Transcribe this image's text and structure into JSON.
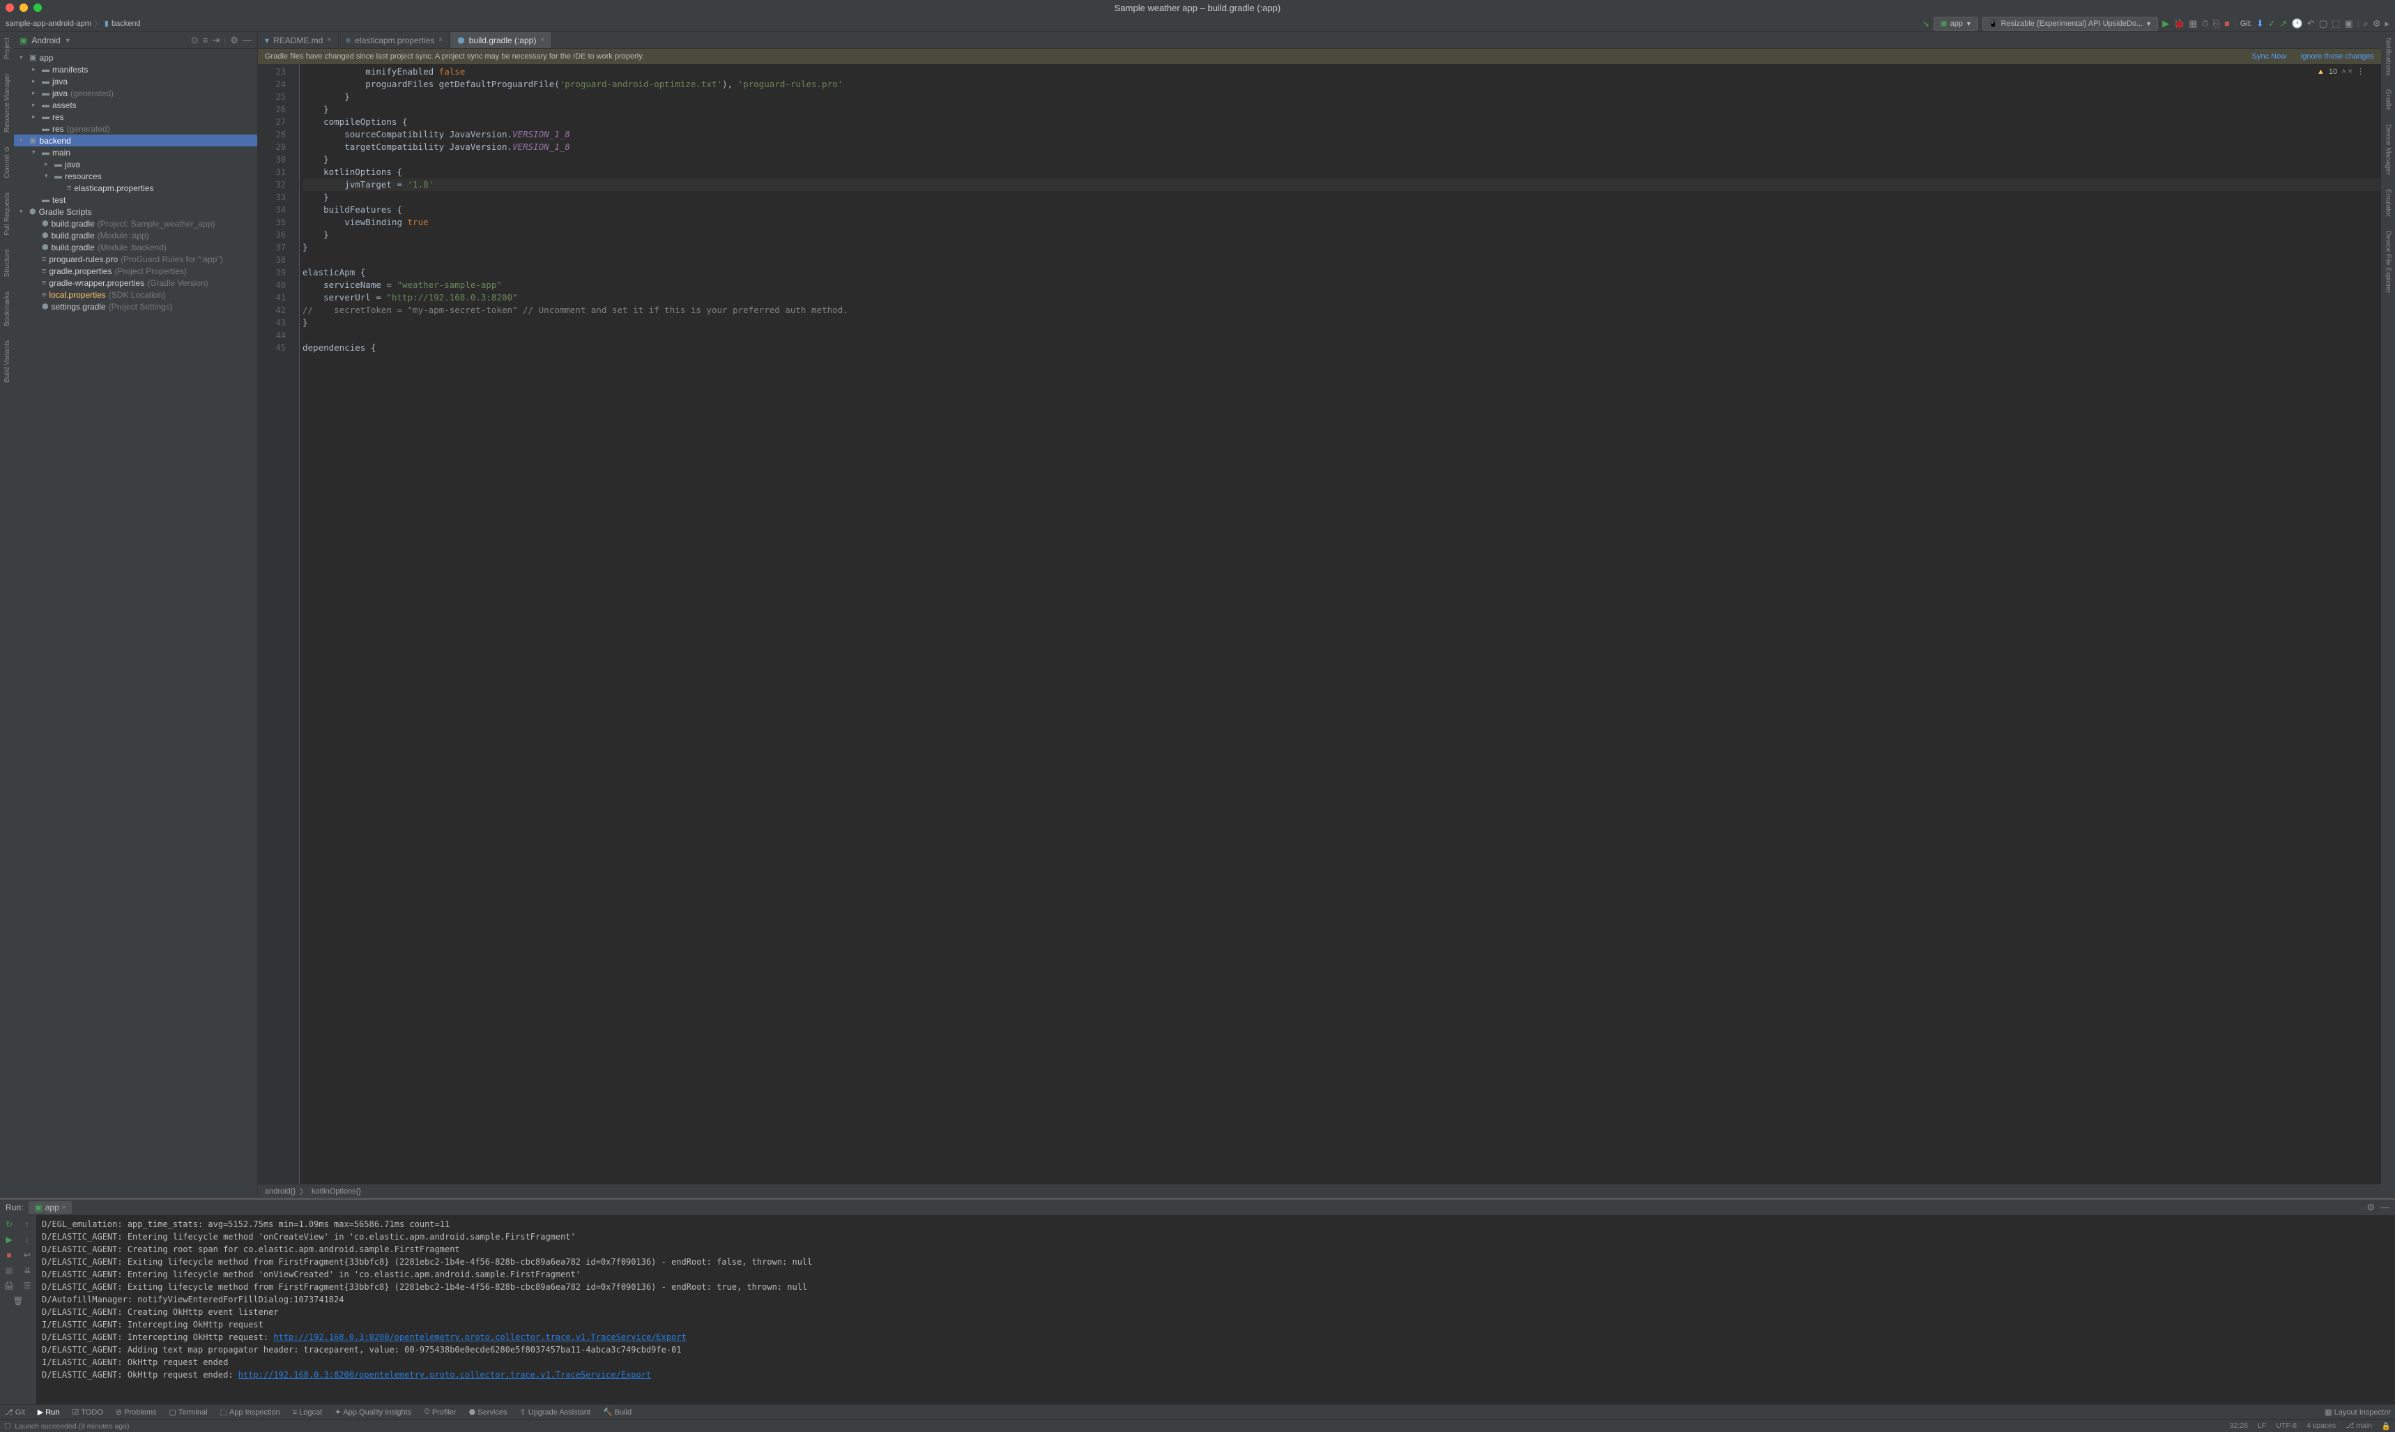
{
  "title": "Sample weather app – build.gradle (:app)",
  "breadcrumb": [
    "sample-app-android-apm",
    "backend"
  ],
  "run_config": "app",
  "device": "Resizable (Experimental) API UpsideDo...",
  "git_label": "Git:",
  "sidebar": {
    "mode": "Android",
    "tree": [
      {
        "d": 0,
        "arr": "v",
        "ic": "module",
        "label": "app",
        "sel": false
      },
      {
        "d": 1,
        "arr": ">",
        "ic": "folder",
        "label": "manifests"
      },
      {
        "d": 1,
        "arr": ">",
        "ic": "folder",
        "label": "java"
      },
      {
        "d": 1,
        "arr": ">",
        "ic": "folder",
        "label": "java",
        "dim": "(generated)"
      },
      {
        "d": 1,
        "arr": ">",
        "ic": "folder",
        "label": "assets"
      },
      {
        "d": 1,
        "arr": ">",
        "ic": "folder",
        "label": "res"
      },
      {
        "d": 1,
        "arr": "",
        "ic": "folder",
        "label": "res",
        "dim": "(generated)"
      },
      {
        "d": 0,
        "arr": "v",
        "ic": "module",
        "label": "backend",
        "sel": true
      },
      {
        "d": 1,
        "arr": "v",
        "ic": "folder",
        "label": "main"
      },
      {
        "d": 2,
        "arr": ">",
        "ic": "folder",
        "label": "java"
      },
      {
        "d": 2,
        "arr": "v",
        "ic": "folder",
        "label": "resources"
      },
      {
        "d": 3,
        "arr": "",
        "ic": "prop",
        "label": "elasticapm.properties"
      },
      {
        "d": 1,
        "arr": "",
        "ic": "folder",
        "label": "test"
      },
      {
        "d": 0,
        "arr": "v",
        "ic": "gradle-group",
        "label": "Gradle Scripts"
      },
      {
        "d": 1,
        "arr": "",
        "ic": "gradle",
        "label": "build.gradle",
        "dim": "(Project: Sample_weather_app)"
      },
      {
        "d": 1,
        "arr": "",
        "ic": "gradle",
        "label": "build.gradle",
        "dim": "(Module :app)"
      },
      {
        "d": 1,
        "arr": "",
        "ic": "gradle",
        "label": "build.gradle",
        "dim": "(Module :backend)"
      },
      {
        "d": 1,
        "arr": "",
        "ic": "txt",
        "label": "proguard-rules.pro",
        "dim": "(ProGuard Rules for \":app\")"
      },
      {
        "d": 1,
        "arr": "",
        "ic": "prop",
        "label": "gradle.properties",
        "dim": "(Project Properties)"
      },
      {
        "d": 1,
        "arr": "",
        "ic": "prop",
        "label": "gradle-wrapper.properties",
        "dim": "(Gradle Version)"
      },
      {
        "d": 1,
        "arr": "",
        "ic": "prop",
        "label": "local.properties",
        "dim": "(SDK Location)",
        "hl": true
      },
      {
        "d": 1,
        "arr": "",
        "ic": "gradle",
        "label": "settings.gradle",
        "dim": "(Project Settings)"
      }
    ]
  },
  "tabs": [
    {
      "label": "README.md",
      "ic": "md",
      "active": false
    },
    {
      "label": "elasticapm.properties",
      "ic": "prop",
      "active": false
    },
    {
      "label": "build.gradle (:app)",
      "ic": "gradle",
      "active": true
    }
  ],
  "sync_msg": "Gradle files have changed since last project sync. A project sync may be necessary for the IDE to work properly.",
  "sync_now": "Sync Now",
  "ignore": "Ignore these changes",
  "warn_count": "10",
  "code": {
    "start": 23,
    "lines": [
      "            minifyEnabled <kw>false</kw>",
      "            proguardFiles getDefaultProguardFile(<str>'proguard-android-optimize.txt'</str>), <str>'proguard-rules.pro'</str>",
      "        }",
      "    }",
      "    compileOptions {",
      "        sourceCompatibility JavaVersion.<prop>VERSION_1_8</prop>",
      "        targetCompatibility JavaVersion.<prop>VERSION_1_8</prop>",
      "    }",
      "    kotlinOptions {",
      "        jvmTarget = <str>'1.8'</str>",
      "    }",
      "    buildFeatures {",
      "        viewBinding <kw>true</kw>",
      "    }",
      "}",
      "",
      "elasticApm {",
      "    serviceName = <str>\"weather-sample-app\"</str>",
      "    serverUrl = <str>\"http://192.168.0.3:8200\"</str>",
      "<cmt>//    secretToken = \"my-apm-secret-token\" // Uncomment and set it if this is your preferred auth method.</cmt>",
      "}",
      "",
      "dependencies {"
    ],
    "cur_line_idx": 9
  },
  "crumbs": [
    "android{}",
    "kotlinOptions{}"
  ],
  "run": {
    "title": "Run:",
    "tab": "app",
    "lines": [
      "D/EGL_emulation: app_time_stats: avg=5152.75ms min=1.09ms max=56586.71ms count=11",
      "D/ELASTIC_AGENT: Entering lifecycle method 'onCreateView' in 'co.elastic.apm.android.sample.FirstFragment'",
      "D/ELASTIC_AGENT: Creating root span for co.elastic.apm.android.sample.FirstFragment",
      "D/ELASTIC_AGENT: Exiting lifecycle method from FirstFragment{33bbfc8} (2281ebc2-1b4e-4f56-828b-cbc89a6ea782 id=0x7f090136) - endRoot: false, thrown: null",
      "D/ELASTIC_AGENT: Entering lifecycle method 'onViewCreated' in 'co.elastic.apm.android.sample.FirstFragment'",
      "D/ELASTIC_AGENT: Exiting lifecycle method from FirstFragment{33bbfc8} (2281ebc2-1b4e-4f56-828b-cbc89a6ea782 id=0x7f090136) - endRoot: true, thrown: null",
      "D/AutofillManager: notifyViewEnteredForFillDialog:1073741824",
      "D/ELASTIC_AGENT: Creating OkHttp event listener",
      "I/ELASTIC_AGENT: Intercepting OkHttp request",
      "D/ELASTIC_AGENT: Intercepting OkHttp request: <url>http://192.168.0.3:8200/opentelemetry.proto.collector.trace.v1.TraceService/Export</url>",
      "D/ELASTIC_AGENT: Adding text map propagator header: traceparent, value: 00-975438b0e0ecde6280e5f8037457ba11-4abca3c749cbd9fe-01",
      "I/ELASTIC_AGENT: OkHttp request ended",
      "D/ELASTIC_AGENT: OkHttp request ended: <url>http://192.168.0.3:8200/opentelemetry.proto.collector.trace.v1.TraceService/Export</url>"
    ]
  },
  "bottom_tools": [
    "Git",
    "Run",
    "TODO",
    "Problems",
    "Terminal",
    "App Inspection",
    "Logcat",
    "App Quality Insights",
    "Profiler",
    "Services",
    "Upgrade Assistant",
    "Build"
  ],
  "layout_inspector": "Layout Inspector",
  "status": {
    "msg": "Launch succeeded (9 minutes ago)",
    "pos": "32:26",
    "le": "LF",
    "enc": "UTF-8",
    "other": "4 spaces",
    "branch": "main"
  },
  "left_rail": [
    "Project",
    "Resource Manager",
    "Commit",
    "Pull Requests",
    "Structure",
    "Bookmarks",
    "Build Variants"
  ]
}
